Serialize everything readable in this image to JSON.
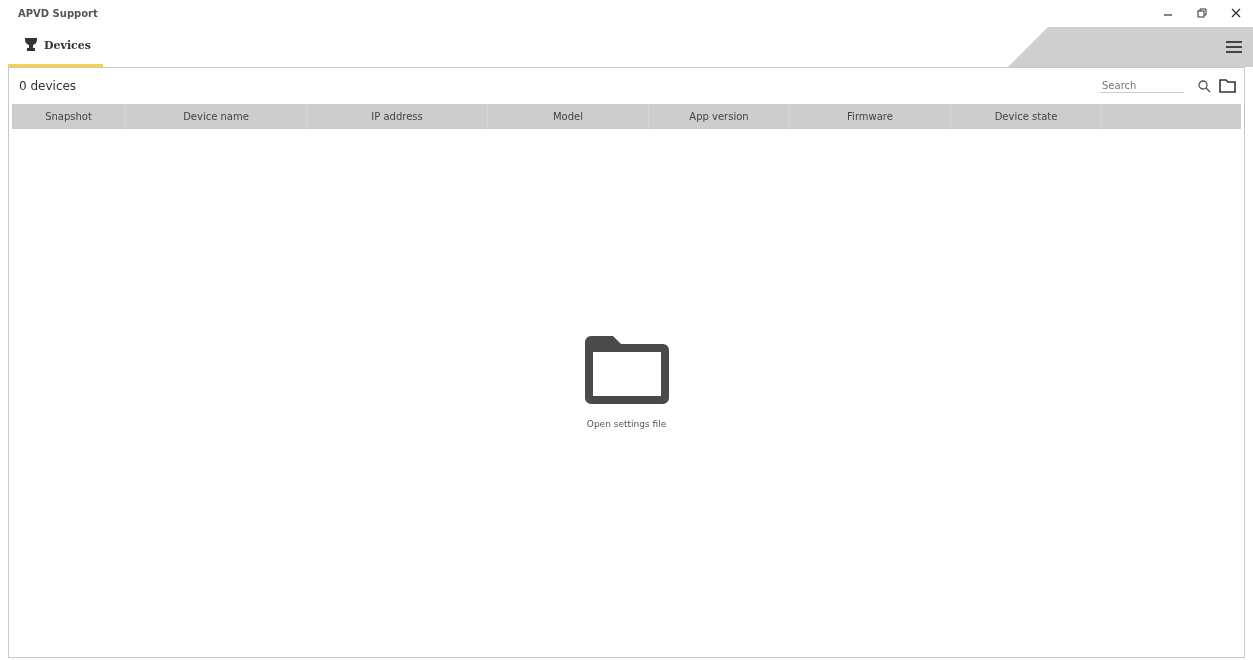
{
  "window": {
    "title": "APVD Support"
  },
  "tabs": [
    {
      "label": "Devices",
      "selected": true
    }
  ],
  "toolbar": {
    "count": "0 devices",
    "search": {
      "placeholder": "Search"
    }
  },
  "table": {
    "columns": [
      "Snapshot",
      "Device name",
      "IP address",
      "Model",
      "App version",
      "Firmware",
      "Device state"
    ]
  },
  "empty_state": {
    "label": "Open settings file"
  }
}
